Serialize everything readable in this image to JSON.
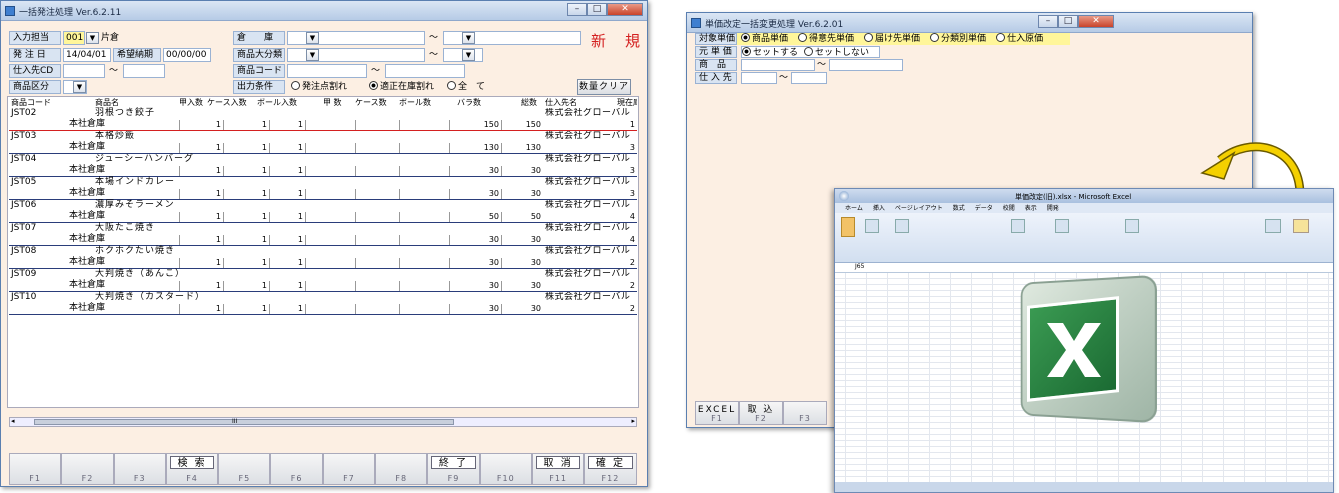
{
  "left_window": {
    "title": "一括発注処理 Ver.6.2.11",
    "status_label": "新　規",
    "fields": {
      "tanto_label": "入力担当",
      "tanto_code": "001",
      "tanto_name": "片倉",
      "soko_label": "倉　　庫",
      "hatchu_label": "発 注 日",
      "hatchu_value": "14/04/01",
      "kibo_label": "希望納期",
      "kibo_value": "00/00/00",
      "daibunrui_label": "商品大分類",
      "shiire_label": "仕入先CD",
      "shohin_code_label": "商品コード",
      "kubun_label": "商品区分",
      "shutsuryoku_label": "出力条件",
      "range_sep": "～"
    },
    "radio_options": [
      {
        "label": "発注点割れ",
        "selected": false
      },
      {
        "label": "適正在庫割れ",
        "selected": true
      },
      {
        "label": "全　て",
        "selected": false
      }
    ],
    "clear_button": "数量クリア",
    "columns": [
      "商品コード",
      "商品名",
      "甲入数",
      "ケース入数",
      "ボール入数",
      "甲 数",
      "ケース数",
      "ボール数",
      "バラ数",
      "総数",
      "仕入先名",
      "現在庫"
    ],
    "rows": [
      {
        "code": "JST02",
        "name": "羽根つき餃子",
        "warehouse": "本社倉庫",
        "kou": "1",
        "case": "1",
        "ball": "1",
        "bara": "150",
        "total": "150",
        "supplier": "株式会社グローバル",
        "stock": "1"
      },
      {
        "code": "JST03",
        "name": "本格炒飯",
        "warehouse": "本社倉庫",
        "kou": "1",
        "case": "1",
        "ball": "1",
        "bara": "130",
        "total": "130",
        "supplier": "株式会社グローバル",
        "stock": "3"
      },
      {
        "code": "JST04",
        "name": "ジューシーハンバーグ",
        "warehouse": "本社倉庫",
        "kou": "1",
        "case": "1",
        "ball": "1",
        "bara": "30",
        "total": "30",
        "supplier": "株式会社グローバル",
        "stock": "3"
      },
      {
        "code": "JST05",
        "name": "本場インドカレー",
        "warehouse": "本社倉庫",
        "kou": "1",
        "case": "1",
        "ball": "1",
        "bara": "30",
        "total": "30",
        "supplier": "株式会社グローバル",
        "stock": "3"
      },
      {
        "code": "JST06",
        "name": "濃厚みそラーメン",
        "warehouse": "本社倉庫",
        "kou": "1",
        "case": "1",
        "ball": "1",
        "bara": "50",
        "total": "50",
        "supplier": "株式会社グローバル",
        "stock": "4"
      },
      {
        "code": "JST07",
        "name": "大阪たこ焼き",
        "warehouse": "本社倉庫",
        "kou": "1",
        "case": "1",
        "ball": "1",
        "bara": "30",
        "total": "30",
        "supplier": "株式会社グローバル",
        "stock": "4"
      },
      {
        "code": "JST08",
        "name": "ホクホクたい焼き",
        "warehouse": "本社倉庫",
        "kou": "1",
        "case": "1",
        "ball": "1",
        "bara": "30",
        "total": "30",
        "supplier": "株式会社グローバル",
        "stock": "2"
      },
      {
        "code": "JST09",
        "name": "大判焼き（あんこ）",
        "warehouse": "本社倉庫",
        "kou": "1",
        "case": "1",
        "ball": "1",
        "bara": "30",
        "total": "30",
        "supplier": "株式会社グローバル",
        "stock": "2"
      },
      {
        "code": "JST10",
        "name": "大判焼き（カスタード）",
        "warehouse": "本社倉庫",
        "kou": "1",
        "case": "1",
        "ball": "1",
        "bara": "30",
        "total": "30",
        "supplier": "株式会社グローバル",
        "stock": "2"
      }
    ],
    "scroll_mark": "III",
    "fkeys": [
      {
        "key": "F1",
        "label": ""
      },
      {
        "key": "F2",
        "label": ""
      },
      {
        "key": "F3",
        "label": ""
      },
      {
        "key": "F4",
        "label": "検 索"
      },
      {
        "key": "F5",
        "label": ""
      },
      {
        "key": "F6",
        "label": ""
      },
      {
        "key": "F7",
        "label": ""
      },
      {
        "key": "F8",
        "label": ""
      },
      {
        "key": "F9",
        "label": "終 了"
      },
      {
        "key": "F10",
        "label": ""
      },
      {
        "key": "F11",
        "label": "取 消"
      },
      {
        "key": "F12",
        "label": "確 定"
      }
    ]
  },
  "right_window": {
    "title": "単価改定一括変更処理 Ver.6.2.01",
    "target_label": "対象単価",
    "target_options": [
      {
        "label": "商品単価",
        "selected": true
      },
      {
        "label": "得意先単価",
        "selected": false
      },
      {
        "label": "届け先単価",
        "selected": false
      },
      {
        "label": "分類別単価",
        "selected": false
      },
      {
        "label": "仕入原価",
        "selected": false
      }
    ],
    "base_label": "元 単 価",
    "base_options": [
      {
        "label": "セットする",
        "selected": true
      },
      {
        "label": "セットしない",
        "selected": false
      }
    ],
    "product_label": "商　品",
    "supplier_label": "仕 入 先",
    "range_sep": "～",
    "fkeys": [
      {
        "key": "F1",
        "label": "EXCEL"
      },
      {
        "key": "F2",
        "label": "取 込"
      },
      {
        "key": "F3",
        "label": ""
      }
    ]
  },
  "excel": {
    "title": "単価改定(旧).xlsx - Microsoft Excel",
    "tabs": [
      "ホーム",
      "挿入",
      "ページレイアウト",
      "数式",
      "データ",
      "校閲",
      "表示",
      "開発"
    ],
    "name_box": "J65",
    "colors": {
      "excel_green": "#1f7a3a",
      "arrow_yellow": "#f4d000"
    }
  }
}
